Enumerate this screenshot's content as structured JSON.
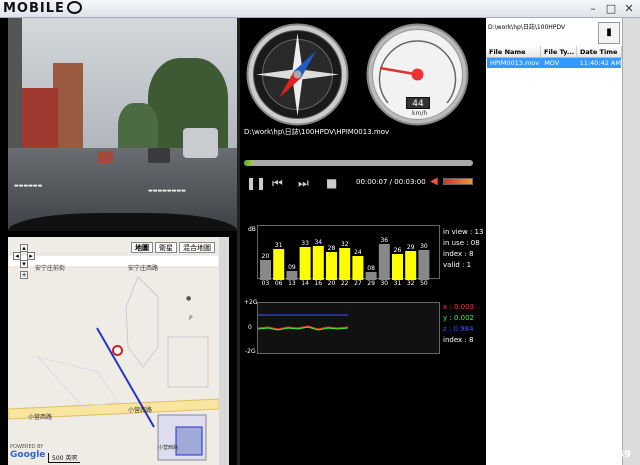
{
  "app": {
    "logo_text": "MOBILE",
    "window_buttons": [
      "–",
      "□",
      "✕"
    ]
  },
  "video": {
    "stamp": "D:\\work\\hp\\日誌\\100HPDV"
  },
  "map": {
    "tabs": [
      "地圖",
      "衛星",
      "混合地圖"
    ],
    "zoom": [
      "+",
      "-"
    ],
    "road_labels": [
      "安宁庄前街",
      "安宁庄西路",
      "小营西路",
      "小营西路",
      "小营西路"
    ],
    "poweredby": "POWERED BY",
    "google": "Google",
    "scale": "500 英呎",
    "route_color": "#2233cc"
  },
  "player": {
    "file_path": "D:\\work\\hp\\日誌\\100HPDV\\HPIM0013.mov",
    "time": "00:00:07 / 00:03:00",
    "progress": 0.04,
    "volume_icon": "speaker-icon",
    "speed_value": "44",
    "speed_unit": "km/h",
    "controls": [
      "pause",
      "prev",
      "next",
      "stop"
    ]
  },
  "satellites": {
    "axis_label": "dB",
    "bars": [
      {
        "id": "03",
        "value": 20,
        "color": "#888"
      },
      {
        "id": "06",
        "value": 31,
        "color": "#ffff00"
      },
      {
        "id": "13",
        "value": 9,
        "color": "#888"
      },
      {
        "id": "14",
        "value": 33,
        "color": "#ffff00"
      },
      {
        "id": "16",
        "value": 34,
        "color": "#ffff00"
      },
      {
        "id": "20",
        "value": 28,
        "color": "#ffff00"
      },
      {
        "id": "22",
        "value": 32,
        "color": "#ffff00"
      },
      {
        "id": "27",
        "value": 24,
        "color": "#ffff00"
      },
      {
        "id": "29",
        "value": 8,
        "color": "#888"
      },
      {
        "id": "30",
        "value": 36,
        "color": "#888"
      },
      {
        "id": "31",
        "value": 26,
        "color": "#ffff00"
      },
      {
        "id": "32",
        "value": 29,
        "color": "#ffff00"
      },
      {
        "id": "50",
        "value": 30,
        "color": "#888"
      }
    ],
    "bar_labels": [
      "20",
      "31",
      "09",
      "33",
      "34",
      "28",
      "32",
      "24",
      "08",
      "36",
      "26",
      "29",
      "30"
    ],
    "info": [
      "in view : 13",
      "in use : 08",
      "index : 8",
      "valid : 1"
    ]
  },
  "accelerometer": {
    "labels": [
      "+2G",
      "0",
      "-2G"
    ],
    "info": [
      {
        "text": "x : 0.003",
        "color": "#ff3333"
      },
      {
        "text": "y : 0.002",
        "color": "#33ff33"
      },
      {
        "text": "z : 0.984",
        "color": "#3355ff"
      },
      {
        "text": "index : 8",
        "color": "#ffffff"
      }
    ]
  },
  "file_list": {
    "path": "D:\\work\\hp\\日誌\\100HPDV",
    "folder_icon": "folder-icon",
    "columns": [
      "File Name",
      "File Ty...",
      "Date Time"
    ],
    "rows": [
      {
        "name": "HPIM0013.mov",
        "type": "MOV",
        "date": "11:40:42 AM"
      }
    ]
  },
  "watermark": "#1420249"
}
